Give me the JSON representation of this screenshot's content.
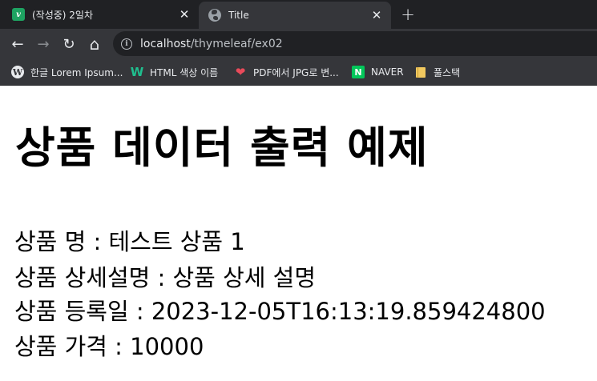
{
  "browser": {
    "tabs": [
      {
        "title": "(작성중) 2일차",
        "icon": "velog-icon",
        "active": false
      },
      {
        "title": "Title",
        "icon": "globe-icon",
        "active": true
      }
    ],
    "url_host": "localhost",
    "url_path": "/thymeleaf/ex02",
    "bookmarks": [
      {
        "label": "한글 Lorem Ipsum...",
        "icon": "wordpress-icon"
      },
      {
        "label": "HTML 색상 이름",
        "icon": "w-logo-icon"
      },
      {
        "label": "PDF에서 JPG로 변...",
        "icon": "heart-icon"
      },
      {
        "label": "NAVER",
        "icon": "naver-icon"
      },
      {
        "label": "풀스택",
        "icon": "folder-icon"
      }
    ],
    "icons": {
      "back": "←",
      "forward": "→",
      "reload": "↻",
      "home": "⌂",
      "close": "✕",
      "new_tab": "+",
      "info": "i"
    }
  },
  "page": {
    "heading": "상품 데이터 출력 예제",
    "lines": [
      "상품 명 : 테스트 상품 1",
      "상품 상세설명 : 상품 상세 설명",
      "상품 등록일 : 2023-12-05T16:13:19.859424800",
      "상품 가격 : 10000"
    ]
  }
}
